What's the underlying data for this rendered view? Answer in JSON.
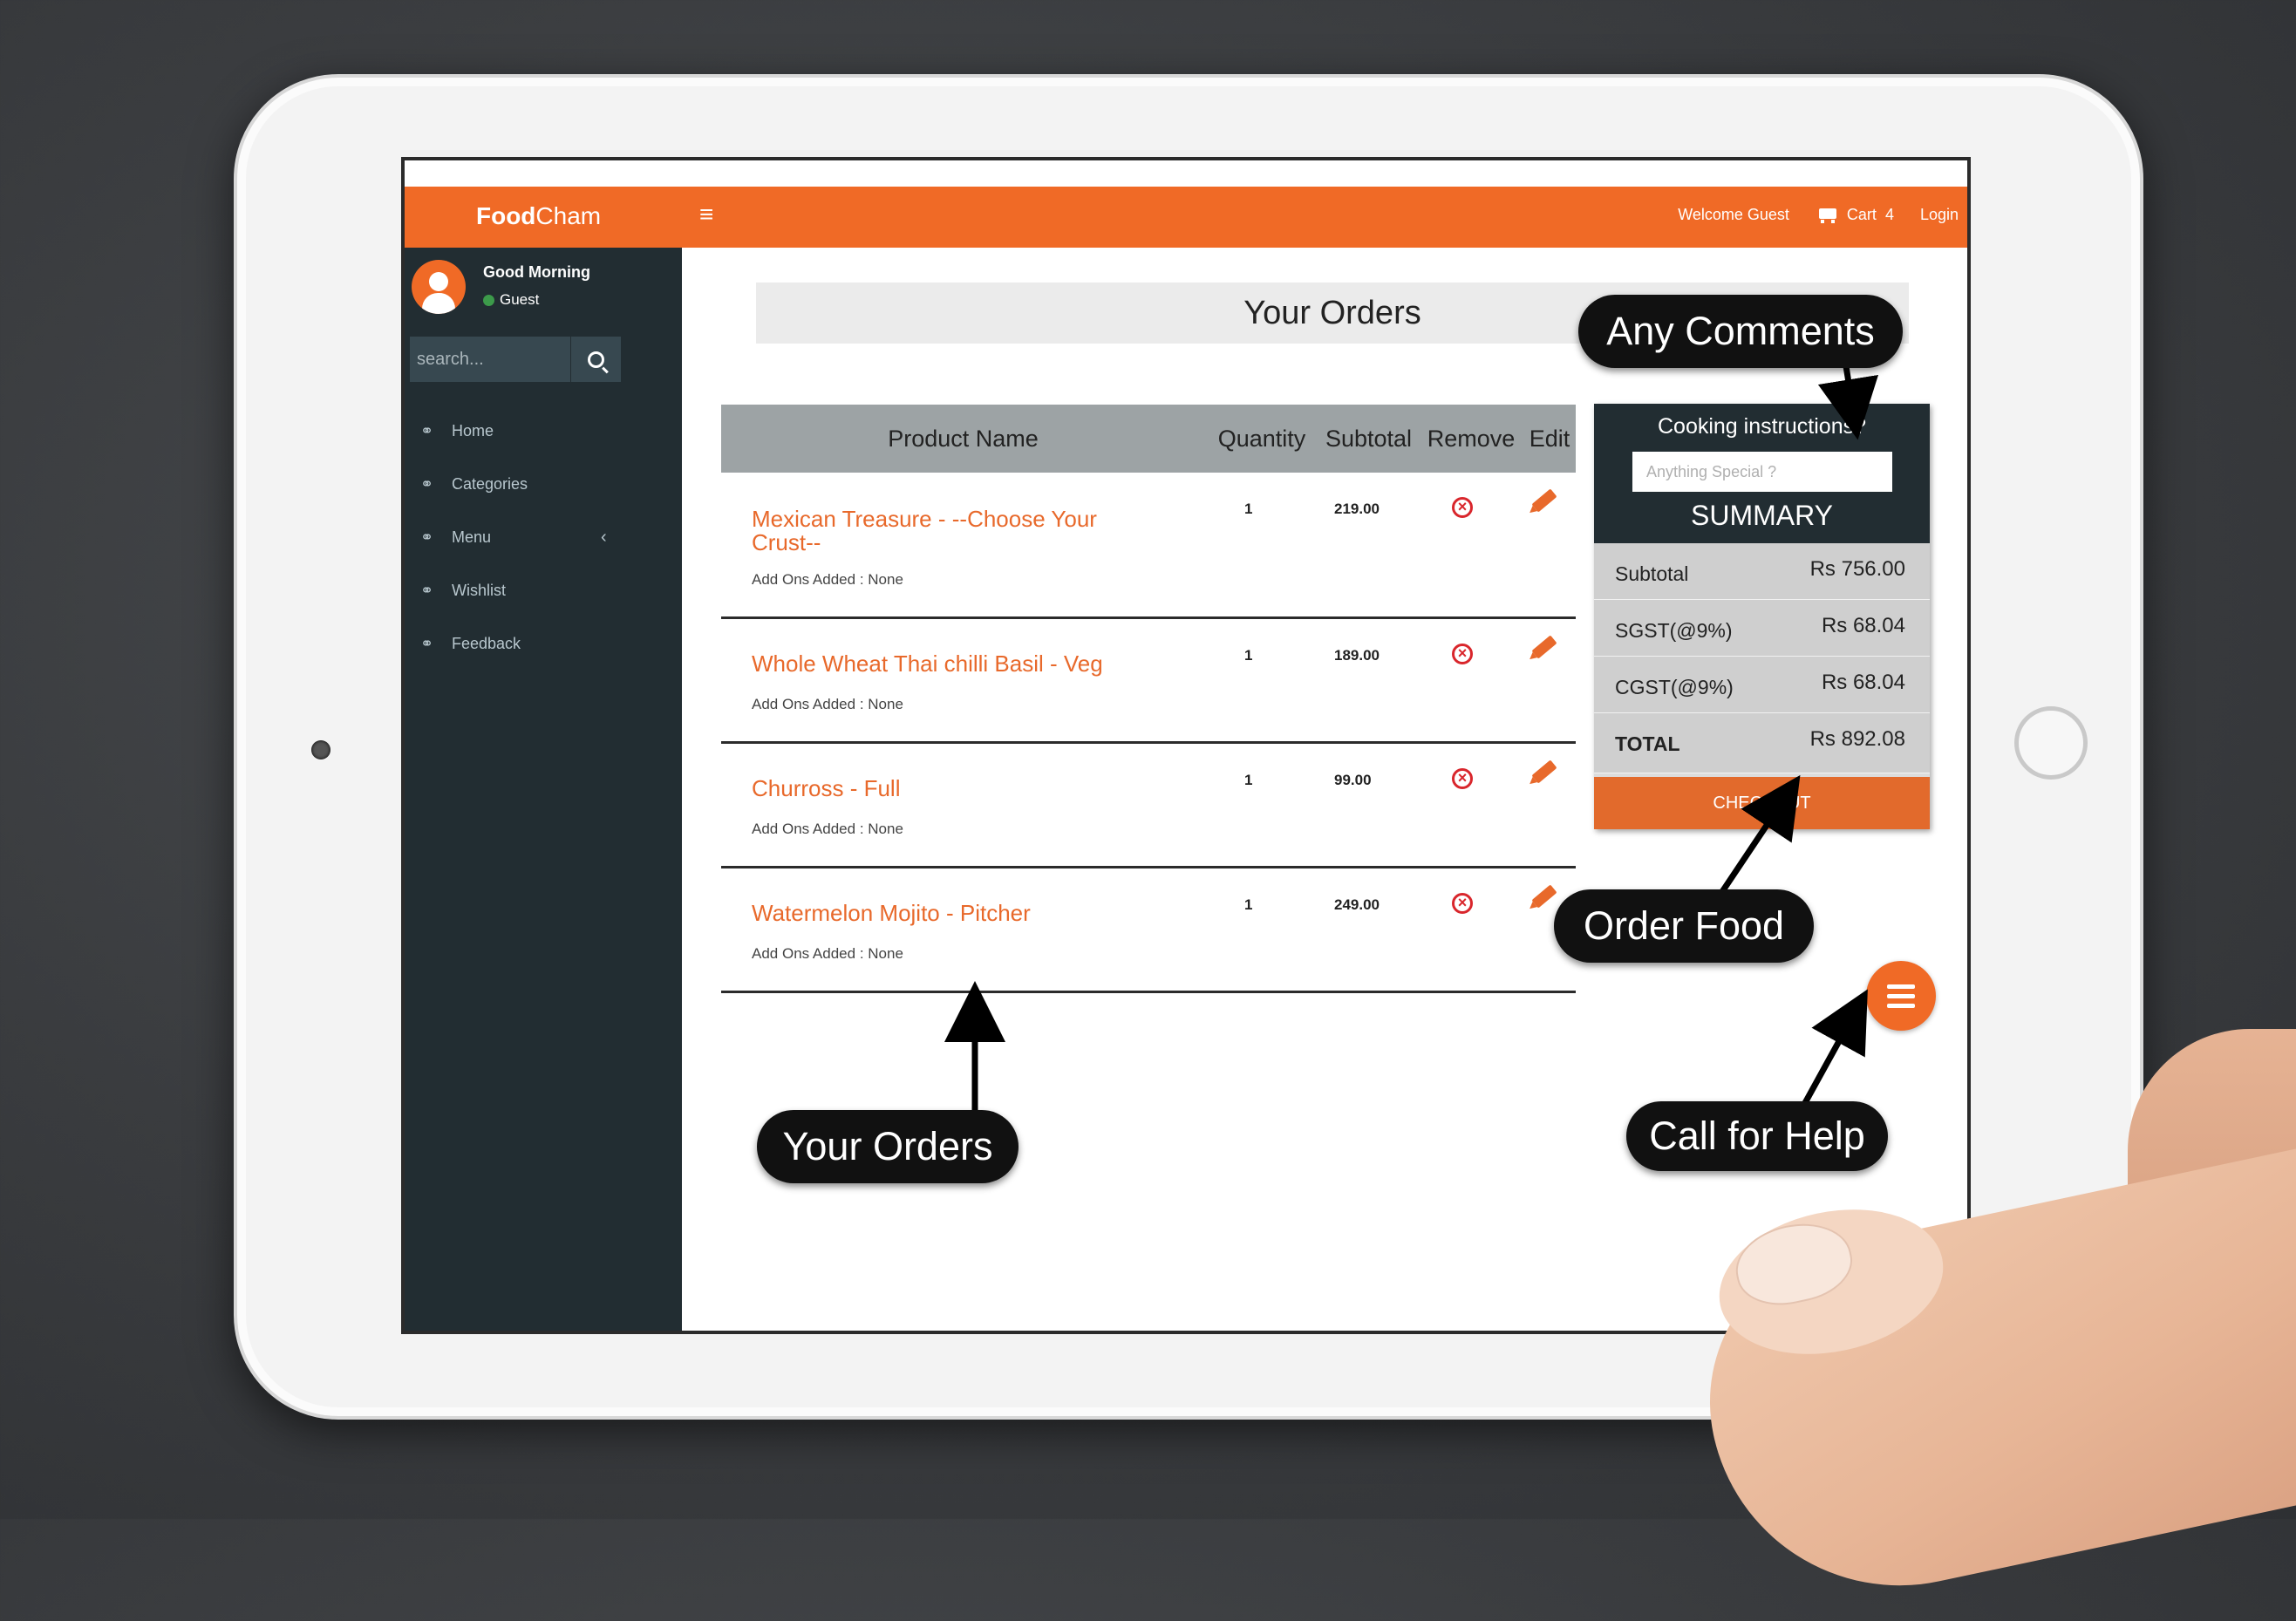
{
  "app": {
    "brand_bold": "Food",
    "brand_light": "Cham",
    "menu_glyph": "≡",
    "welcome": "Welcome Guest",
    "cart_label": "Cart",
    "cart_count": "4",
    "login": "Login"
  },
  "sidebar": {
    "greeting": "Good Morning",
    "user": "Guest",
    "search_placeholder": "search...",
    "items": [
      {
        "label": "Home",
        "icon": "link-icon"
      },
      {
        "label": "Categories",
        "icon": "link-icon"
      },
      {
        "label": "Menu",
        "icon": "link-icon",
        "chevron": "‹"
      },
      {
        "label": "Wishlist",
        "icon": "link-icon"
      },
      {
        "label": "Feedback",
        "icon": "link-icon"
      }
    ]
  },
  "page": {
    "title": "Your Orders"
  },
  "table": {
    "headers": [
      "Product Name",
      "Quantity",
      "Subtotal",
      "Remove",
      "Edit"
    ],
    "rows": [
      {
        "name": "Mexican Treasure - --Choose Your Crust--",
        "addons": "Add Ons Added : None",
        "qty": "1",
        "subtotal": "219.00"
      },
      {
        "name": "Whole Wheat Thai chilli Basil - Veg",
        "addons": "Add Ons Added : None",
        "qty": "1",
        "subtotal": "189.00"
      },
      {
        "name": "Churross - Full",
        "addons": "Add Ons Added : None",
        "qty": "1",
        "subtotal": "99.00"
      },
      {
        "name": "Watermelon Mojito - Pitcher",
        "addons": "Add Ons Added : None",
        "qty": "1",
        "subtotal": "249.00"
      }
    ]
  },
  "summary": {
    "cooking_label": "Cooking instructions?",
    "cooking_placeholder": "Anything Special ?",
    "title": "SUMMARY",
    "rows": [
      {
        "label": "Subtotal",
        "value": "Rs 756.00"
      },
      {
        "label": "SGST(@9%)",
        "value": "Rs 68.04"
      },
      {
        "label": "CGST(@9%)",
        "value": "Rs 68.04"
      },
      {
        "label": "TOTAL",
        "value": "Rs 892.08"
      }
    ],
    "checkout": "CHECKOUT"
  },
  "callouts": {
    "comments": "Any Comments",
    "order_food": "Order Food",
    "your_orders": "Your Orders",
    "help": "Call for Help"
  },
  "colors": {
    "accent": "#f06a26",
    "sidebar": "#222d32",
    "link": "#e8692b"
  }
}
